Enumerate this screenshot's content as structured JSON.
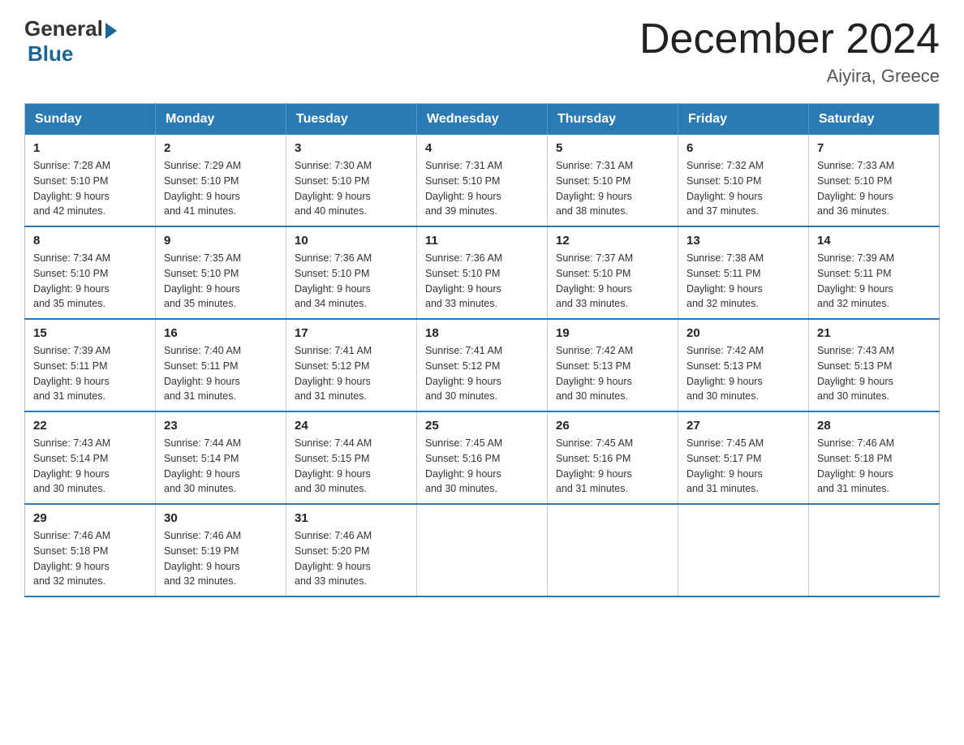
{
  "logo": {
    "general_text": "General",
    "blue_text": "Blue"
  },
  "header": {
    "title": "December 2024",
    "location": "Aiyira, Greece"
  },
  "days_of_week": [
    "Sunday",
    "Monday",
    "Tuesday",
    "Wednesday",
    "Thursday",
    "Friday",
    "Saturday"
  ],
  "weeks": [
    [
      {
        "day": "1",
        "sunrise": "7:28 AM",
        "sunset": "5:10 PM",
        "daylight": "9 hours and 42 minutes."
      },
      {
        "day": "2",
        "sunrise": "7:29 AM",
        "sunset": "5:10 PM",
        "daylight": "9 hours and 41 minutes."
      },
      {
        "day": "3",
        "sunrise": "7:30 AM",
        "sunset": "5:10 PM",
        "daylight": "9 hours and 40 minutes."
      },
      {
        "day": "4",
        "sunrise": "7:31 AM",
        "sunset": "5:10 PM",
        "daylight": "9 hours and 39 minutes."
      },
      {
        "day": "5",
        "sunrise": "7:31 AM",
        "sunset": "5:10 PM",
        "daylight": "9 hours and 38 minutes."
      },
      {
        "day": "6",
        "sunrise": "7:32 AM",
        "sunset": "5:10 PM",
        "daylight": "9 hours and 37 minutes."
      },
      {
        "day": "7",
        "sunrise": "7:33 AM",
        "sunset": "5:10 PM",
        "daylight": "9 hours and 36 minutes."
      }
    ],
    [
      {
        "day": "8",
        "sunrise": "7:34 AM",
        "sunset": "5:10 PM",
        "daylight": "9 hours and 35 minutes."
      },
      {
        "day": "9",
        "sunrise": "7:35 AM",
        "sunset": "5:10 PM",
        "daylight": "9 hours and 35 minutes."
      },
      {
        "day": "10",
        "sunrise": "7:36 AM",
        "sunset": "5:10 PM",
        "daylight": "9 hours and 34 minutes."
      },
      {
        "day": "11",
        "sunrise": "7:36 AM",
        "sunset": "5:10 PM",
        "daylight": "9 hours and 33 minutes."
      },
      {
        "day": "12",
        "sunrise": "7:37 AM",
        "sunset": "5:10 PM",
        "daylight": "9 hours and 33 minutes."
      },
      {
        "day": "13",
        "sunrise": "7:38 AM",
        "sunset": "5:11 PM",
        "daylight": "9 hours and 32 minutes."
      },
      {
        "day": "14",
        "sunrise": "7:39 AM",
        "sunset": "5:11 PM",
        "daylight": "9 hours and 32 minutes."
      }
    ],
    [
      {
        "day": "15",
        "sunrise": "7:39 AM",
        "sunset": "5:11 PM",
        "daylight": "9 hours and 31 minutes."
      },
      {
        "day": "16",
        "sunrise": "7:40 AM",
        "sunset": "5:11 PM",
        "daylight": "9 hours and 31 minutes."
      },
      {
        "day": "17",
        "sunrise": "7:41 AM",
        "sunset": "5:12 PM",
        "daylight": "9 hours and 31 minutes."
      },
      {
        "day": "18",
        "sunrise": "7:41 AM",
        "sunset": "5:12 PM",
        "daylight": "9 hours and 30 minutes."
      },
      {
        "day": "19",
        "sunrise": "7:42 AM",
        "sunset": "5:13 PM",
        "daylight": "9 hours and 30 minutes."
      },
      {
        "day": "20",
        "sunrise": "7:42 AM",
        "sunset": "5:13 PM",
        "daylight": "9 hours and 30 minutes."
      },
      {
        "day": "21",
        "sunrise": "7:43 AM",
        "sunset": "5:13 PM",
        "daylight": "9 hours and 30 minutes."
      }
    ],
    [
      {
        "day": "22",
        "sunrise": "7:43 AM",
        "sunset": "5:14 PM",
        "daylight": "9 hours and 30 minutes."
      },
      {
        "day": "23",
        "sunrise": "7:44 AM",
        "sunset": "5:14 PM",
        "daylight": "9 hours and 30 minutes."
      },
      {
        "day": "24",
        "sunrise": "7:44 AM",
        "sunset": "5:15 PM",
        "daylight": "9 hours and 30 minutes."
      },
      {
        "day": "25",
        "sunrise": "7:45 AM",
        "sunset": "5:16 PM",
        "daylight": "9 hours and 30 minutes."
      },
      {
        "day": "26",
        "sunrise": "7:45 AM",
        "sunset": "5:16 PM",
        "daylight": "9 hours and 31 minutes."
      },
      {
        "day": "27",
        "sunrise": "7:45 AM",
        "sunset": "5:17 PM",
        "daylight": "9 hours and 31 minutes."
      },
      {
        "day": "28",
        "sunrise": "7:46 AM",
        "sunset": "5:18 PM",
        "daylight": "9 hours and 31 minutes."
      }
    ],
    [
      {
        "day": "29",
        "sunrise": "7:46 AM",
        "sunset": "5:18 PM",
        "daylight": "9 hours and 32 minutes."
      },
      {
        "day": "30",
        "sunrise": "7:46 AM",
        "sunset": "5:19 PM",
        "daylight": "9 hours and 32 minutes."
      },
      {
        "day": "31",
        "sunrise": "7:46 AM",
        "sunset": "5:20 PM",
        "daylight": "9 hours and 33 minutes."
      },
      null,
      null,
      null,
      null
    ]
  ],
  "labels": {
    "sunrise": "Sunrise:",
    "sunset": "Sunset:",
    "daylight": "Daylight:"
  }
}
